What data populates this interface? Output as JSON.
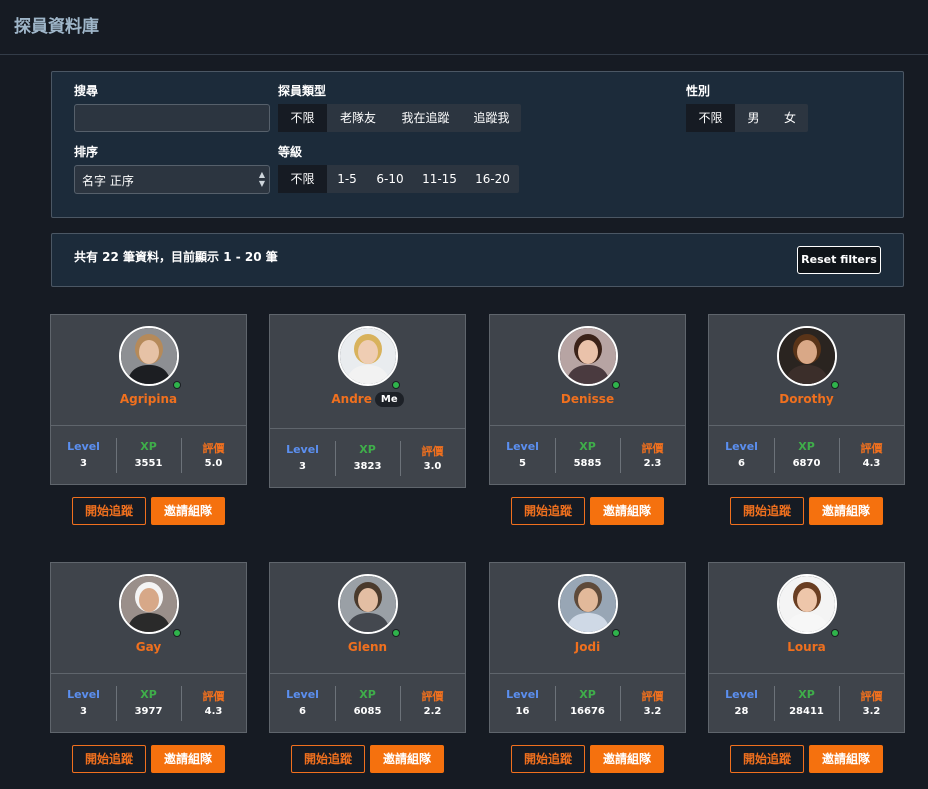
{
  "page": {
    "title": "探員資料庫"
  },
  "filters": {
    "search_label": "搜尋",
    "search_value": "",
    "search_placeholder": "",
    "type_label": "探員類型",
    "type_options": [
      "不限",
      "老隊友",
      "我在追蹤",
      "追蹤我"
    ],
    "type_selected": "不限",
    "gender_label": "性別",
    "gender_options": [
      "不限",
      "男",
      "女"
    ],
    "gender_selected": "不限",
    "sort_label": "排序",
    "sort_value": "名字 正序",
    "level_label": "等級",
    "level_options": [
      "不限",
      "1-5",
      "6-10",
      "11-15",
      "16-20"
    ],
    "level_selected": "不限"
  },
  "summary": {
    "text": "共有 22 筆資料，目前顯示 1 - 20 筆",
    "reset_label": "Reset filters"
  },
  "stat_labels": {
    "level": "Level",
    "xp": "XP",
    "rating": "評價"
  },
  "buttons": {
    "follow": "開始追蹤",
    "invite": "邀請組隊"
  },
  "me_badge": "Me",
  "agents": [
    {
      "name": "Agripina",
      "level": "3",
      "xp": "3551",
      "rating": "5.0",
      "online": true,
      "is_me": false,
      "avatar": "avatar-agripina"
    },
    {
      "name": "Andre",
      "level": "3",
      "xp": "3823",
      "rating": "3.0",
      "online": true,
      "is_me": true,
      "avatar": "avatar-andre"
    },
    {
      "name": "Denisse",
      "level": "5",
      "xp": "5885",
      "rating": "2.3",
      "online": true,
      "is_me": false,
      "avatar": "avatar-denisse"
    },
    {
      "name": "Dorothy",
      "level": "6",
      "xp": "6870",
      "rating": "4.3",
      "online": true,
      "is_me": false,
      "avatar": "avatar-dorothy"
    },
    {
      "name": "Gay",
      "level": "3",
      "xp": "3977",
      "rating": "4.3",
      "online": true,
      "is_me": false,
      "avatar": "avatar-gay"
    },
    {
      "name": "Glenn",
      "level": "6",
      "xp": "6085",
      "rating": "2.2",
      "online": true,
      "is_me": false,
      "avatar": "avatar-glenn"
    },
    {
      "name": "Jodi",
      "level": "16",
      "xp": "16676",
      "rating": "3.2",
      "online": true,
      "is_me": false,
      "avatar": "avatar-jodi"
    },
    {
      "name": "Loura",
      "level": "28",
      "xp": "28411",
      "rating": "3.2",
      "online": true,
      "is_me": false,
      "avatar": "avatar-loura"
    }
  ],
  "colors": {
    "accent": "#f5710e",
    "level": "#5b8ff0",
    "xp": "#3fae4a",
    "rating": "#f0701e",
    "online": "#2fb34b",
    "panel": "#1c2b3a",
    "card": "#3f444b"
  }
}
